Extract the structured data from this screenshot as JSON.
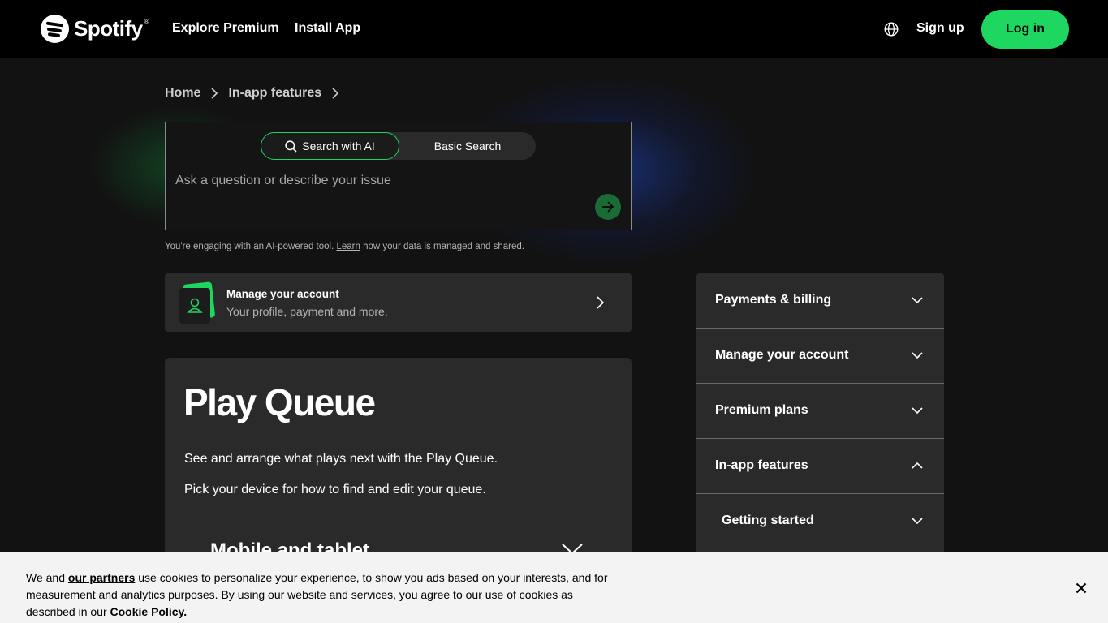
{
  "header": {
    "brand": "Spotify",
    "brand_mark": "®",
    "nav": [
      "Explore Premium",
      "Install App"
    ],
    "language_icon": "globe-icon",
    "signup_label": "Sign up",
    "login_label": "Log in",
    "accent": "#1ed760"
  },
  "breadcrumb": [
    "Home",
    "In-app features"
  ],
  "search": {
    "mode_ai": "Search with AI",
    "mode_basic": "Basic Search",
    "placeholder": "Ask a question or describe your issue",
    "disclaimer_pre": "You're engaging with an AI-powered tool.",
    "disclaimer_link": "Learn",
    "disclaimer_post": "how your data is managed and shared."
  },
  "account_card": {
    "title": "Manage your account",
    "subtitle": "Your profile, payment and more."
  },
  "article": {
    "title": "Play Queue",
    "p1": "See and arrange what plays next with the Play Queue.",
    "p2": "Pick your device for how to find and edit your queue.",
    "section": "Mobile and tablet"
  },
  "sidebar": {
    "items": [
      {
        "label": "Payments & billing",
        "expanded": false
      },
      {
        "label": "Manage your account",
        "expanded": false
      },
      {
        "label": "Premium plans",
        "expanded": false
      },
      {
        "label": "In-app features",
        "expanded": true
      }
    ],
    "sub_items": [
      {
        "label": "Getting started",
        "expanded": false
      }
    ]
  },
  "cookie": {
    "pre": "We and",
    "partners_link": "our partners",
    "mid": "use cookies to personalize your experience, to show you ads based on your interests, and for measurement and analytics purposes. By using our website and services, you agree to our use of cookies as described in our",
    "policy_link": "Cookie Policy."
  }
}
